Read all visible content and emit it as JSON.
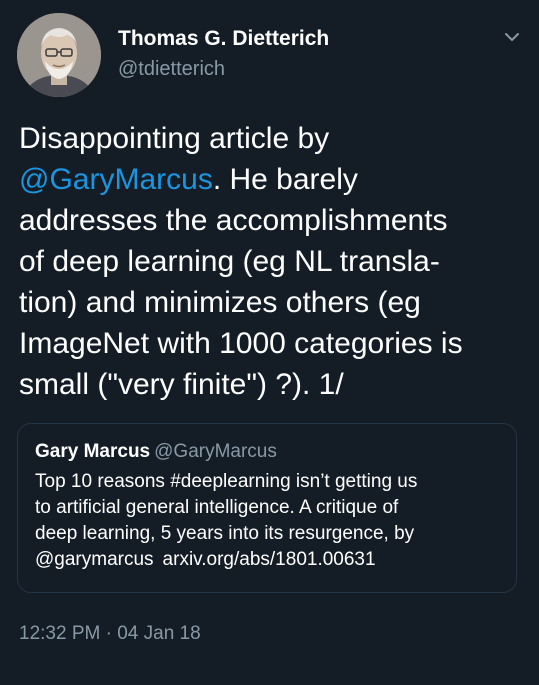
{
  "author": {
    "display_name": "Thomas G. Dietterich",
    "handle": "@tdietterich"
  },
  "tweet": {
    "line1": "Disappointing article by",
    "mention": "@GaryMarcus",
    "line2_rest": ". He barely",
    "line3": "addresses the accomplishments",
    "line4": "of deep learning (eg NL transla-",
    "line5": "tion) and minimizes others (eg",
    "line6": "ImageNet with 1000 categories is",
    "line7": "small (\"very finite\") ?). 1/"
  },
  "quoted_tweet": {
    "display_name": "Gary Marcus",
    "handle": "@GaryMarcus",
    "line1": "Top 10 reasons #deeplearning isn’t getting us",
    "line2": "to artificial general intelligence. A critique of",
    "line3": "deep learning, 5 years into its resurgence, by",
    "mention": "@garymarcus",
    "link": "arxiv.org/abs/1801.00631"
  },
  "timestamp": "12:32 PM · 04 Jan 18",
  "icons": {
    "menu": "chevron-down-icon"
  },
  "colors": {
    "background": "#141d26",
    "text": "#ffffff",
    "secondary": "#8899a6",
    "link": "#1b95e0",
    "border": "#243447"
  }
}
